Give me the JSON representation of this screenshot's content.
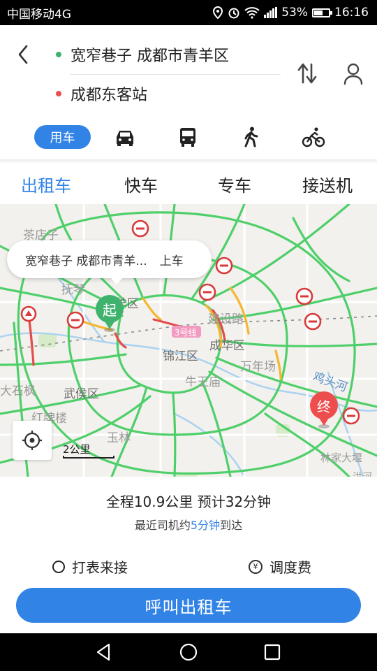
{
  "status_bar": {
    "carrier": "中国移动4G",
    "battery": "53%",
    "time": "16:16",
    "icons": [
      "location-icon",
      "alarm-icon",
      "wifi-icon",
      "signal-icon",
      "battery-icon"
    ]
  },
  "route": {
    "from": "宽窄巷子 成都市青羊区",
    "to": "成都东客站",
    "from_dot_color": "#3fb36d",
    "to_dot_color": "#ee4d4d"
  },
  "modes": {
    "active_label": "用车",
    "icons": [
      "car-icon",
      "bus-icon",
      "walk-icon",
      "bike-icon"
    ]
  },
  "services": {
    "tabs": [
      "出租车",
      "快车",
      "专车",
      "接送机"
    ],
    "active_index": 0
  },
  "map": {
    "callout_place": "宽窄巷子 成都市青羊...",
    "callout_action": "上车",
    "start_marker": "起",
    "end_marker": "终",
    "scale": "2公里",
    "labels": {
      "l1": "茶店子",
      "l2": "抚琴",
      "l3": "青羊区",
      "l4": "建设路",
      "l5": "3号线",
      "l6": "锦江区",
      "l7": "成华区",
      "l8": "万年场",
      "l9": "牛王庙",
      "l10": "鸡头河",
      "l11": "大石枫",
      "l12": "武侯区",
      "l13": "红牌楼",
      "l14": "玉林",
      "l15": "林家大堰",
      "l16": "洪河"
    }
  },
  "trip": {
    "summary": "全程10.9公里 预计32分钟",
    "eta_prefix": "最近司机约",
    "eta_value": "5分钟",
    "eta_suffix": "到达"
  },
  "options": {
    "meter": "打表来接",
    "dispatch_fee": "调度费",
    "dispatch_symbol": "¥"
  },
  "call_button": "呼叫出租车",
  "colors": {
    "accent": "#3283e6",
    "road_clear": "#4fcf6a",
    "road_slow": "#f5b731",
    "road_jam": "#e54c4c"
  }
}
